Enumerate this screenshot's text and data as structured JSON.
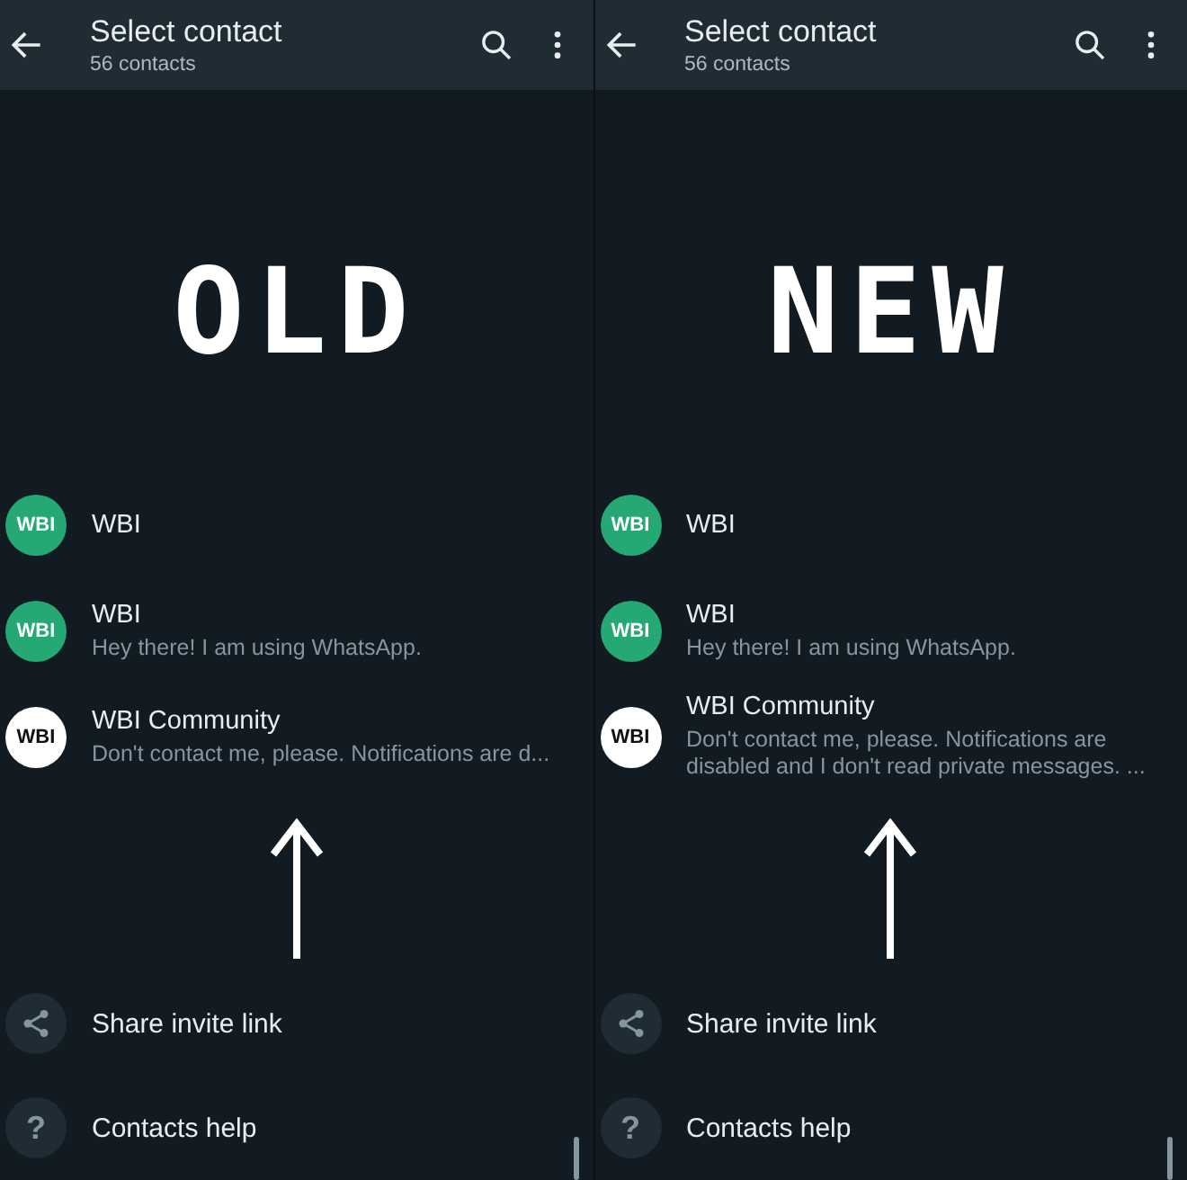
{
  "panels": [
    {
      "title": "Select contact",
      "subtitle": "56 contacts",
      "label": "OLD",
      "contacts": [
        {
          "avatar": "WBI",
          "kind": "brand",
          "name": "WBI"
        },
        {
          "avatar": "WBI",
          "kind": "brand",
          "name": "WBI",
          "status": "Hey there! I am using WhatsApp."
        },
        {
          "avatar": "WBI",
          "kind": "community",
          "name": "WBI Community",
          "status": "Don't contact me, please. Notifications are d..."
        }
      ],
      "actions": [
        {
          "kind": "share",
          "label": "Share invite link"
        },
        {
          "kind": "help",
          "icon": "?",
          "label": "Contacts help"
        }
      ]
    },
    {
      "title": "Select contact",
      "subtitle": "56 contacts",
      "label": "NEW",
      "contacts": [
        {
          "avatar": "WBI",
          "kind": "brand",
          "name": "WBI"
        },
        {
          "avatar": "WBI",
          "kind": "brand",
          "name": "WBI",
          "status": "Hey there! I am using WhatsApp."
        },
        {
          "avatar": "WBI",
          "kind": "community",
          "name": "WBI Community",
          "status": "Don't contact me, please. Notifications are disabled and I don't read private messages. ..."
        }
      ],
      "actions": [
        {
          "kind": "share",
          "label": "Share invite link"
        },
        {
          "kind": "help",
          "icon": "?",
          "label": "Contacts help"
        }
      ]
    }
  ]
}
